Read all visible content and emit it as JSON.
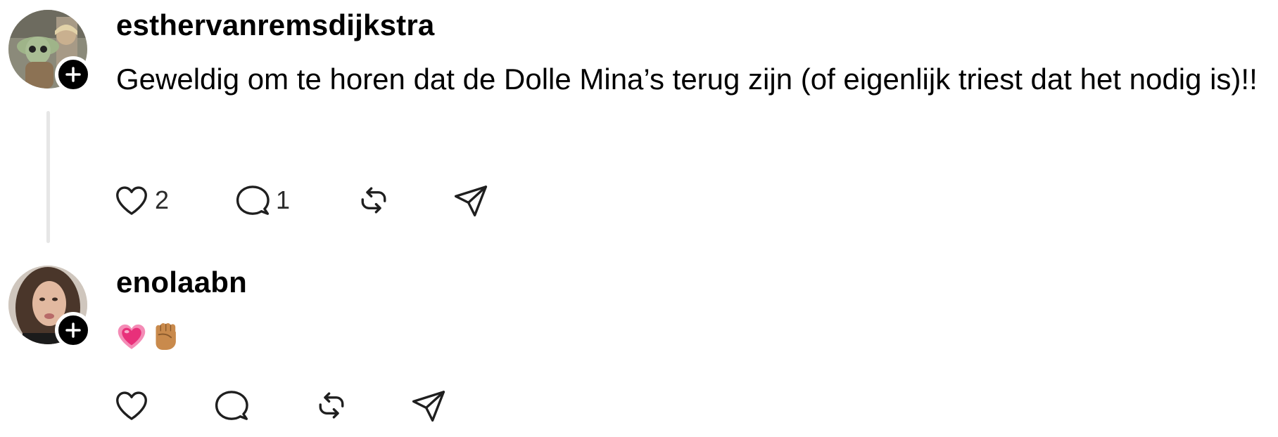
{
  "posts": [
    {
      "username": "esthervanremsdijkstra",
      "text": "Geweldig om te horen dat de Dolle Mina’s terug zijn (of eigenlijk triest dat het nodig is)!!",
      "likes": "2",
      "replies": "1",
      "has_thread_line": true
    },
    {
      "username": "enolaabn",
      "emojis": [
        "heart-pulse-emoji",
        "raised-fist-emoji"
      ],
      "has_thread_line": false
    }
  ],
  "colors": {
    "text": "#000000",
    "icon_stroke": "#1f1f1f",
    "thread_line": "#e6e6e6",
    "heart_emoji": "#e8307a",
    "fist_emoji": "#c98a4c"
  },
  "icons": {
    "like": "heart-outline-icon",
    "reply": "speech-bubble-icon",
    "repost": "repost-arrows-icon",
    "share": "paper-plane-icon",
    "follow": "plus-icon"
  }
}
